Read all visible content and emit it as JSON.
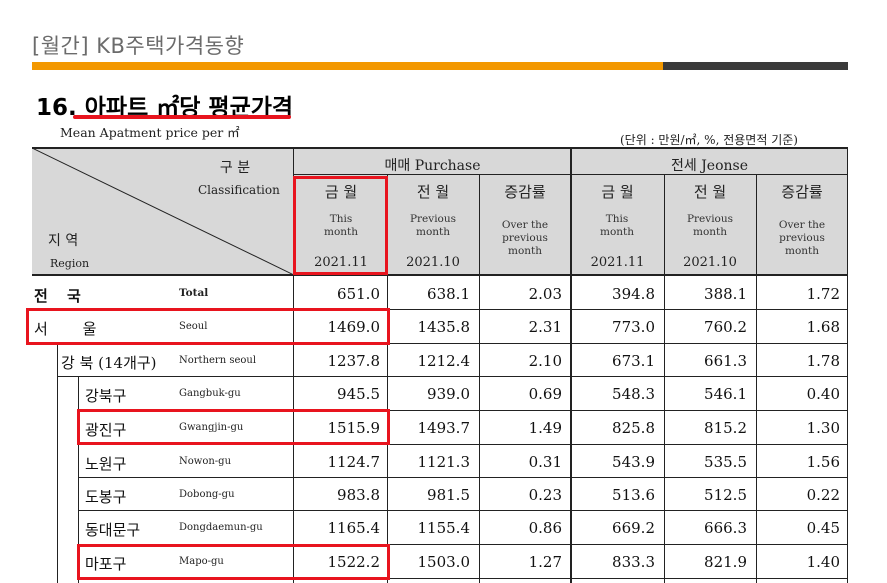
{
  "header": {
    "title": "[월간] KB주택가격동향"
  },
  "section": {
    "title": "16. 아파트 ㎡당 평균가격",
    "subtitle": "Mean Apatment price per ㎡",
    "unit_note": "(단위 : 만원/㎡, %, 전용면적 기준)"
  },
  "table": {
    "corner": {
      "class_kr": "구 분",
      "class_en": "Classification",
      "region_kr": "지 역",
      "region_en": "Region"
    },
    "groups": [
      {
        "kr": "매매 Purchase"
      },
      {
        "kr": "전세 Jeonse"
      }
    ],
    "cols": [
      {
        "kr": "금 월",
        "en": "This month",
        "date": "2021.11"
      },
      {
        "kr": "전 월",
        "en": "Previous month",
        "date": "2021.10"
      },
      {
        "kr": "증감률",
        "en": "Over the previous month",
        "date": ""
      },
      {
        "kr": "금 월",
        "en": "This month",
        "date": "2021.11"
      },
      {
        "kr": "전 월",
        "en": "Previous month",
        "date": "2021.10"
      },
      {
        "kr": "증감률",
        "en": "Over the previous month",
        "date": ""
      }
    ],
    "rows": [
      {
        "kr": "전 국",
        "en": "Total",
        "values": [
          "651.0",
          "638.1",
          "2.03",
          "394.8",
          "388.1",
          "1.72"
        ]
      },
      {
        "kr": "서 울",
        "en": "Seoul",
        "values": [
          "1469.0",
          "1435.8",
          "2.31",
          "773.0",
          "760.2",
          "1.68"
        ]
      },
      {
        "kr": "강 북 (14개구)",
        "en": "Northern seoul",
        "values": [
          "1237.8",
          "1212.4",
          "2.10",
          "673.1",
          "661.3",
          "1.78"
        ]
      },
      {
        "kr": "강북구",
        "en": "Gangbuk-gu",
        "values": [
          "945.5",
          "939.0",
          "0.69",
          "548.3",
          "546.1",
          "0.40"
        ]
      },
      {
        "kr": "광진구",
        "en": "Gwangjin-gu",
        "values": [
          "1515.9",
          "1493.7",
          "1.49",
          "825.8",
          "815.2",
          "1.30"
        ]
      },
      {
        "kr": "노원구",
        "en": "Nowon-gu",
        "values": [
          "1124.7",
          "1121.3",
          "0.31",
          "543.9",
          "535.5",
          "1.56"
        ]
      },
      {
        "kr": "도봉구",
        "en": "Dobong-gu",
        "values": [
          "983.8",
          "981.5",
          "0.23",
          "513.6",
          "512.5",
          "0.22"
        ]
      },
      {
        "kr": "동대문구",
        "en": "Dongdaemun-gu",
        "values": [
          "1165.4",
          "1155.4",
          "0.86",
          "669.2",
          "666.3",
          "0.45"
        ]
      },
      {
        "kr": "마포구",
        "en": "Mapo-gu",
        "values": [
          "1522.2",
          "1503.0",
          "1.27",
          "833.3",
          "821.9",
          "1.40"
        ]
      }
    ]
  },
  "colors": {
    "accent_orange": "#f39800",
    "dark_bar": "#3a3a3a",
    "highlight_red": "#e8141e",
    "header_bg": "#d8d8d8"
  }
}
